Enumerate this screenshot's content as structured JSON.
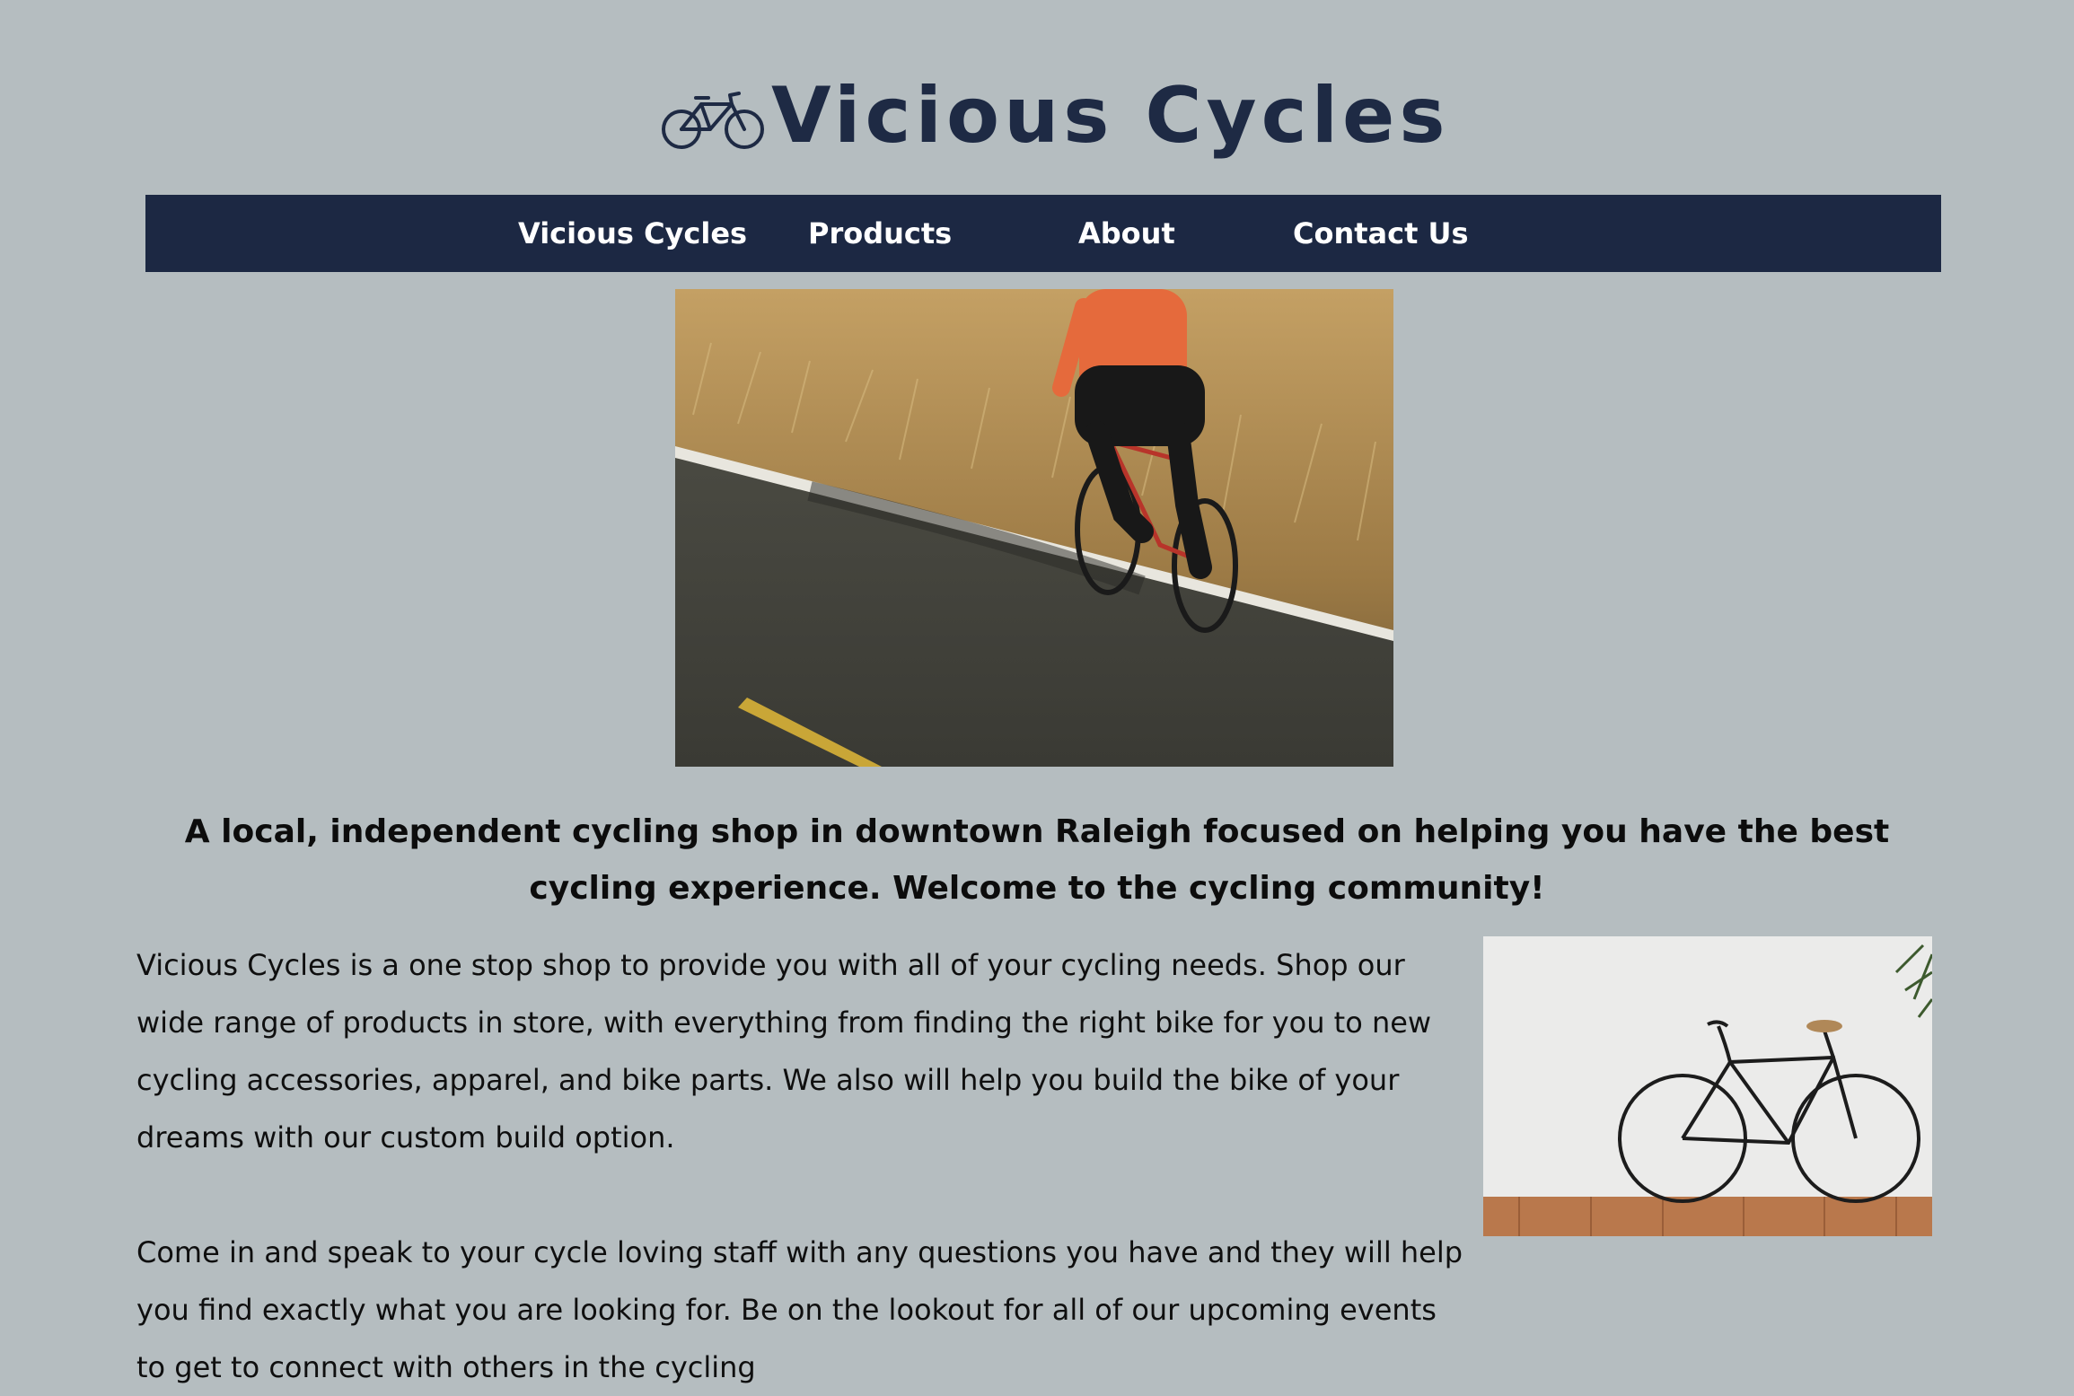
{
  "header": {
    "logo_icon": "bicycle-icon",
    "brand_name": "Vicious Cycles"
  },
  "nav": {
    "items": [
      {
        "label": "Vicious Cycles"
      },
      {
        "label": "Products"
      },
      {
        "label": "About"
      },
      {
        "label": "Contact Us"
      }
    ]
  },
  "hero": {
    "image": "cyclist-road-photo"
  },
  "main": {
    "tagline": "A local, independent cycling shop in downtown Raleigh focused on helping you have the best cycling experience. Welcome to the cycling community!",
    "paragraph_1": "Vicious Cycles is a one stop shop to provide you with all of your cycling needs. Shop our wide range of products in store, with everything from finding the right bike for you to new cycling accessories, apparel, and bike parts. We also will help you build the bike of your dreams with our custom build option.",
    "paragraph_2": "Come in and speak to your cycle loving staff with any questions you have and they will help you find exactly what you are looking for. Be on the lookout for all of our upcoming events to get to connect with others in the cycling",
    "side_image": "bicycle-against-wall-photo"
  },
  "colors": {
    "page_background": "#b5bdc0",
    "nav_background": "#1c2843",
    "brand": "#1e2a44"
  }
}
